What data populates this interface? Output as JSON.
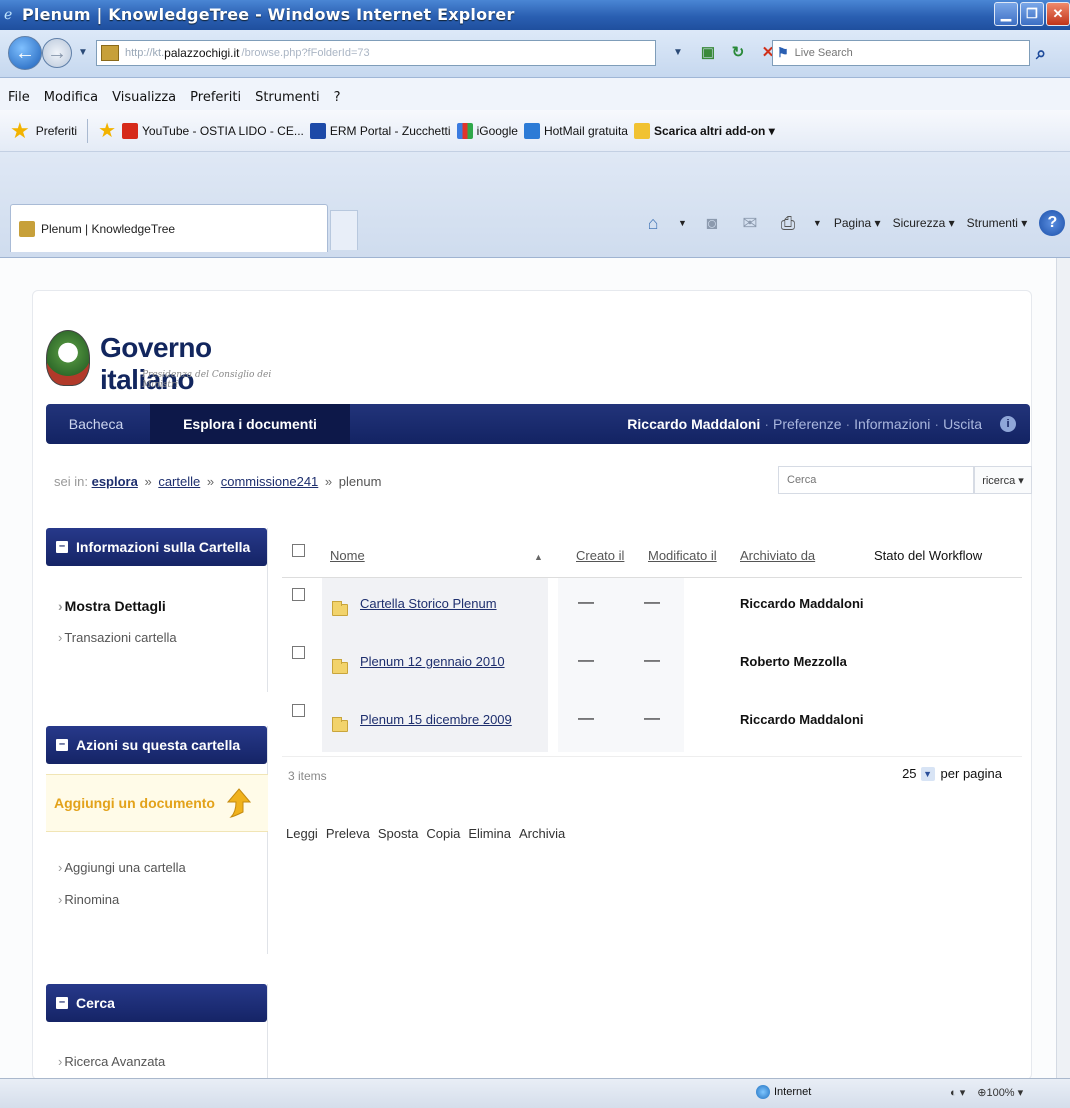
{
  "window": {
    "title": "Plenum | KnowledgeTree - Windows Internet Explorer"
  },
  "address": {
    "prefix": "http://kt.",
    "host": "palazzochigi.it",
    "path": "/browse.php?fFolderId=73"
  },
  "livesearch": {
    "placeholder": "Live Search"
  },
  "menu": [
    "File",
    "Modifica",
    "Visualizza",
    "Preferiti",
    "Strumenti",
    "?"
  ],
  "favorites": {
    "label": "Preferiti",
    "items": [
      "YouTube - OSTIA LIDO - CE...",
      "ERM Portal - Zucchetti",
      "iGoogle",
      "HotMail gratuita",
      "Scarica altri add-on ▾"
    ]
  },
  "tab": {
    "label": "Plenum | KnowledgeTree"
  },
  "commandbar": {
    "pagina": "Pagina ▾",
    "sicurezza": "Sicurezza ▾",
    "strumenti": "Strumenti ▾"
  },
  "logo": {
    "text": "Governo italiano",
    "sub": "Presidenza del Consiglio dei Ministri"
  },
  "nav": {
    "bacheca": "Bacheca",
    "esplora": "Esplora i documenti",
    "user": "Riccardo Maddaloni",
    "preferenze": "Preferenze",
    "informazioni": "Informazioni",
    "uscita": "Uscita",
    "sep": "·"
  },
  "breadcrumb": {
    "pre": "sei in:",
    "esplora": "esplora",
    "cartelle": "cartelle",
    "commissione": "commissione241",
    "current": "plenum",
    "sep": "»"
  },
  "search": {
    "placeholder": "Cerca",
    "button": "ricerca ▾"
  },
  "sidebar": {
    "info_title": "Informazioni sulla Cartella",
    "mostra": "Mostra Dettagli",
    "transazioni": "Transazioni cartella",
    "azioni_title": "Azioni su questa cartella",
    "aggiungi_doc": "Aggiungi un documento",
    "aggiungi_cartella": "Aggiungi una cartella",
    "rinomina": "Rinomina",
    "cerca_title": "Cerca",
    "ricerca_avanzata": "Ricerca Avanzata"
  },
  "table": {
    "headers": {
      "nome": "Nome",
      "creato": "Creato il",
      "modificato": "Modificato il",
      "archiviato": "Archiviato da",
      "stato": "Stato del Workflow"
    },
    "rows": [
      {
        "name": "Cartella Storico Plenum",
        "created": "—",
        "modified": "—",
        "owner": "Riccardo Maddaloni"
      },
      {
        "name": "Plenum 12 gennaio 2010",
        "created": "—",
        "modified": "—",
        "owner": "Roberto Mezzolla"
      },
      {
        "name": "Plenum 15 dicembre 2009",
        "created": "—",
        "modified": "—",
        "owner": "Riccardo Maddaloni"
      }
    ],
    "items_count": "3 items",
    "per_page_value": "25",
    "per_page_label": "per pagina"
  },
  "actions": [
    "Leggi",
    "Preleva",
    "Sposta",
    "Copia",
    "Elimina",
    "Archivia"
  ],
  "status": {
    "zone": "Internet",
    "zoom": "100%"
  },
  "colors": {
    "nav_bg": "#152466",
    "accent_gold": "#e3a21a",
    "link": "#1e2f6e"
  }
}
